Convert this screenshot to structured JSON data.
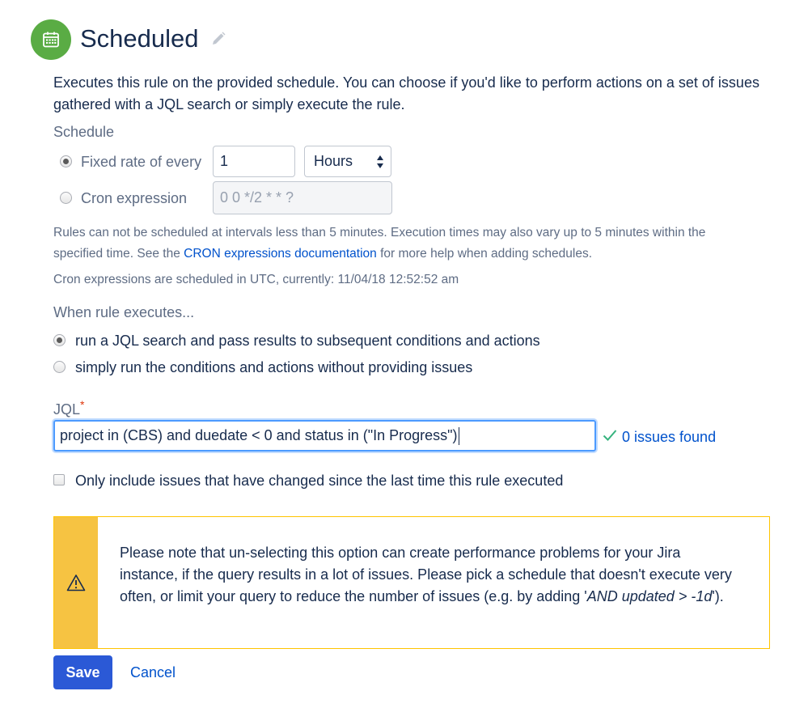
{
  "header": {
    "title": "Scheduled",
    "icon": "calendar-icon",
    "edit_icon": "pencil-icon",
    "icon_bg": "#5AAC44"
  },
  "description": "Executes this rule on the provided schedule. You can choose if you'd like to perform actions on a set of issues gathered with a JQL search or simply execute the rule.",
  "schedule": {
    "label": "Schedule",
    "fixed_rate": {
      "label": "Fixed rate of every",
      "selected": true,
      "value": "1",
      "unit": "Hours"
    },
    "cron": {
      "label": "Cron expression",
      "selected": false,
      "placeholder": "0 0 */2 * * ?"
    },
    "note_line1": "Rules can not be scheduled at intervals less than 5 minutes. Execution times may also vary up to 5 minutes within the",
    "note_line2_prefix": "specified time. See the ",
    "note_link": "CRON expressions documentation",
    "note_line2_suffix": " for more help when adding schedules.",
    "utc_note": "Cron expressions are scheduled in UTC, currently: 11/04/18 12:52:52 am"
  },
  "execution": {
    "label": "When rule executes...",
    "options": [
      {
        "label": "run a JQL search and pass results to subsequent conditions and actions",
        "selected": true
      },
      {
        "label": "simply run the conditions and actions without providing issues",
        "selected": false
      }
    ]
  },
  "jql": {
    "label": "JQL",
    "required_marker": "*",
    "value": "project in (CBS) and duedate < 0 and status in (\"In Progress\")",
    "result": "0 issues found",
    "result_icon": "checkmark-icon"
  },
  "only_changed": {
    "label": "Only include issues that have changed since the last time this rule executed",
    "checked": false
  },
  "warning": {
    "icon": "warning-icon",
    "text": "Please note that un-selecting this option can create performance problems for your Jira instance, if the query results in a lot of issues. Please pick a schedule that doesn't execute very often, or limit your query to reduce the number of issues (e.g. by adding '",
    "code": "AND updated > -1d",
    "text_end": "')."
  },
  "actions": {
    "save": "Save",
    "cancel": "Cancel"
  }
}
